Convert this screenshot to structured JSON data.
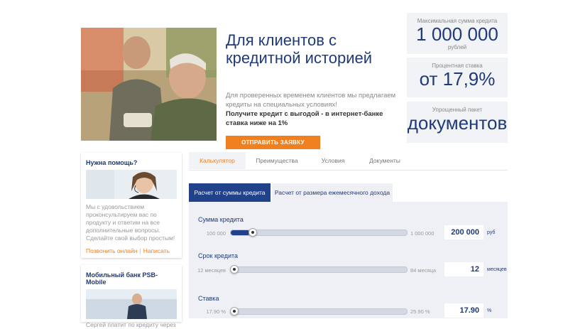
{
  "hero": {
    "title": "Для клиентов с кредитной историей",
    "text": "Для проверенных временем клиентов мы предлагаем кредиты на специальных условиях!",
    "bold_text": "Получите кредит с выгодой - в интернет-банке ставка ниже на 1%",
    "apply_button": "Отправить заявку"
  },
  "stats": [
    {
      "label": "Максимальная сумма кредита",
      "value": "1 000 000",
      "sub": "рублей"
    },
    {
      "label": "Процентная ставка",
      "value": "от 17,9%",
      "sub": ""
    },
    {
      "label": "Упрощенный пакет",
      "value": "документов",
      "sub": ""
    }
  ],
  "help_card": {
    "title": "Нужна помощь?",
    "text": "Мы с удовольствием проконсультируем вас по продукту и ответим на все дополнительные вопросы. Сделайте свой выбор простым!",
    "call_link": "Позвонить онлайн",
    "separator": "|",
    "write_link": "Написать"
  },
  "mobile_card": {
    "title": "Мобильный банк PSB-Mobile",
    "text": "Сергей платит по кредиту через"
  },
  "tabs": [
    "Калькулятор",
    "Преимущества",
    "Условия",
    "Документы"
  ],
  "subtabs": [
    "Расчет от суммы кредита",
    "Расчет от размера ежемесячного дохода"
  ],
  "calculator": {
    "amount": {
      "label": "Сумма кредита",
      "min": "100 000",
      "max": "1 000 000",
      "value": "200 000",
      "unit": "руб",
      "fraction": 0.11
    },
    "term": {
      "label": "Срок кредита",
      "min": "12 месяцев",
      "max": "84 месяца",
      "value": "12",
      "unit": "месяцев",
      "fraction": 0.0
    },
    "rate": {
      "label": "Ставка",
      "min": "17.90 %",
      "max": "25.90 %",
      "value": "17.90",
      "unit": "%",
      "fraction": 0.0
    }
  }
}
